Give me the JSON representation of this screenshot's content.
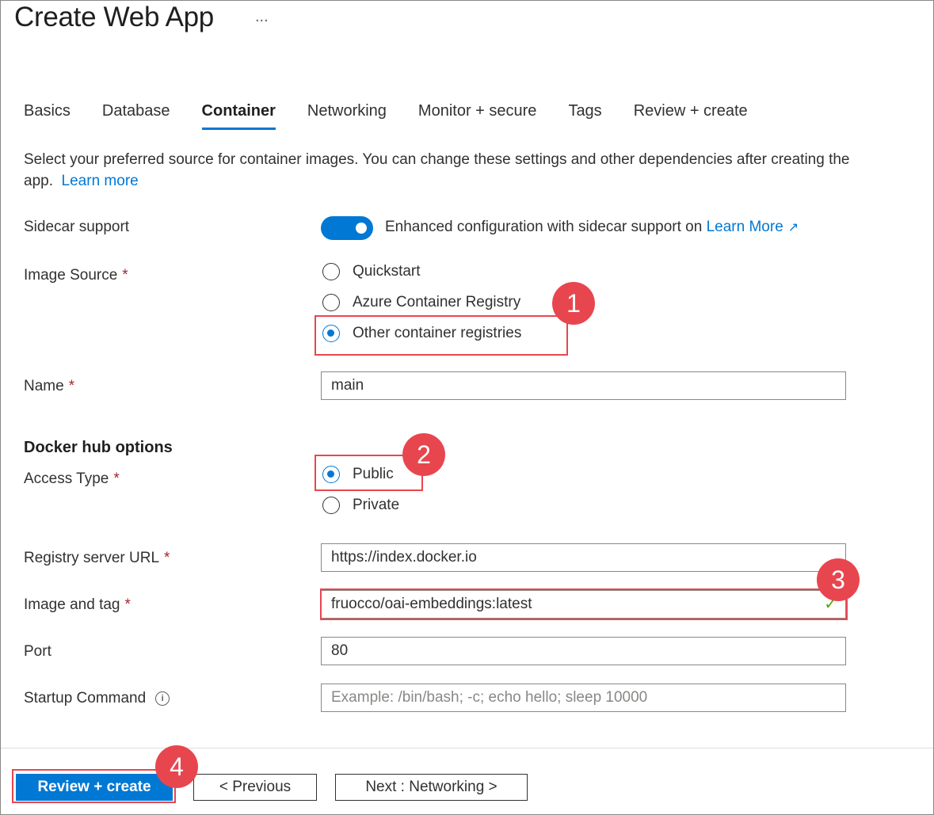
{
  "title": "Create Web App",
  "title_more": "...",
  "tabs": [
    {
      "label": "Basics",
      "active": false
    },
    {
      "label": "Database",
      "active": false
    },
    {
      "label": "Container",
      "active": true
    },
    {
      "label": "Networking",
      "active": false
    },
    {
      "label": "Monitor + secure",
      "active": false
    },
    {
      "label": "Tags",
      "active": false
    },
    {
      "label": "Review + create",
      "active": false
    }
  ],
  "intro": {
    "text": "Select your preferred source for container images. You can change these settings and other dependencies after creating the app.",
    "link": "Learn more"
  },
  "sidecar": {
    "label": "Sidecar support",
    "toggle_on": true,
    "description": "Enhanced configuration with sidecar support on",
    "link": "Learn More"
  },
  "image_source": {
    "label": "Image Source",
    "required": "*",
    "options": [
      "Quickstart",
      "Azure Container Registry",
      "Other container registries"
    ],
    "selected": "Other container registries"
  },
  "name": {
    "label": "Name",
    "required": "*",
    "value": "main"
  },
  "docker_hub": {
    "section_title": "Docker hub options",
    "access_type": {
      "label": "Access Type",
      "required": "*",
      "options": [
        "Public",
        "Private"
      ],
      "selected": "Public"
    }
  },
  "registry_url": {
    "label": "Registry server URL",
    "required": "*",
    "value": "https://index.docker.io"
  },
  "image_tag": {
    "label": "Image and tag",
    "required": "*",
    "value": "fruocco/oai-embeddings:latest",
    "valid_icon": "✓"
  },
  "port": {
    "label": "Port",
    "value": "80"
  },
  "startup_command": {
    "label": "Startup Command",
    "placeholder": "Example: /bin/bash; -c; echo hello; sleep 10000",
    "info_icon": "i"
  },
  "buttons": {
    "review_create": "Review + create",
    "previous": "< Previous",
    "next": "Next : Networking >"
  },
  "callouts": [
    "1",
    "2",
    "3",
    "4"
  ],
  "colors": {
    "accent": "#0078d4",
    "highlight": "#e8464e",
    "required": "#a4262c",
    "valid": "#57a300"
  }
}
